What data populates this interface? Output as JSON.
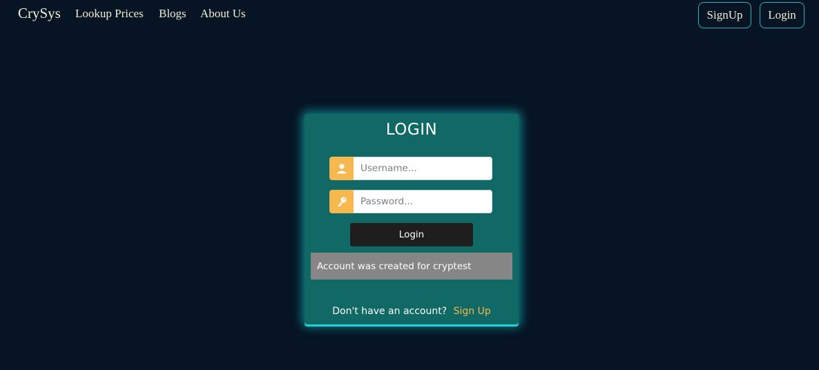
{
  "navbar": {
    "brand": "CrySys",
    "links": [
      {
        "label": "Lookup Prices"
      },
      {
        "label": "Blogs"
      },
      {
        "label": "About Us"
      }
    ],
    "signup_label": "SignUp",
    "login_label": "Login"
  },
  "login_card": {
    "title": "LOGIN",
    "username": {
      "icon": "user-icon",
      "placeholder": "Username...",
      "value": ""
    },
    "password": {
      "icon": "key-icon",
      "placeholder": "Password...",
      "value": ""
    },
    "submit_label": "Login",
    "message": "Account was created for cryptest",
    "signup_prompt": "Don't have an account?",
    "signup_link": "Sign Up"
  },
  "colors": {
    "background": "#061423",
    "card": "#106965",
    "accent": "#f7b94f",
    "glow": "#27d6d9",
    "button": "#1e1e1e",
    "alert": "#868686"
  }
}
